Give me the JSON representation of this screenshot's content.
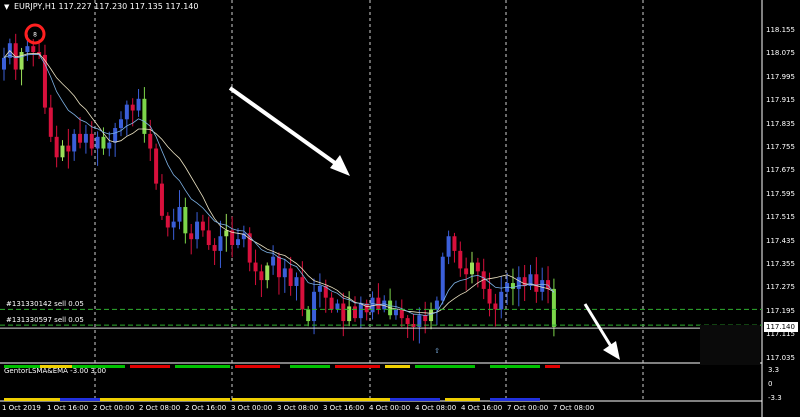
{
  "header": {
    "symbol": "EURJPY,H1",
    "ohlc": "117.227 117.230 117.135 117.140",
    "marker_digit": "8"
  },
  "orders": [
    {
      "label": "#131330142 sell 0.05",
      "price": 117.2
    },
    {
      "label": "#131330597 sell 0.05",
      "price": 117.146
    }
  ],
  "indicator": {
    "title": "GentorLSMA&EMA -3.00 3.00",
    "ticks": [
      "3.3",
      "0",
      "-3.3"
    ]
  },
  "price_axis": {
    "labels": [
      "118.155",
      "118.075",
      "117.995",
      "117.915",
      "117.835",
      "117.755",
      "117.675",
      "117.595",
      "117.515",
      "117.435",
      "117.355",
      "117.275",
      "117.195",
      "117.115",
      "117.035"
    ],
    "current_price": "117.140"
  },
  "time_axis": {
    "labels": [
      "1 Oct 2019",
      "1 Oct 16:00",
      "2 Oct 00:00",
      "2 Oct 08:00",
      "2 Oct 16:00",
      "3 Oct 00:00",
      "3 Oct 08:00",
      "3 Oct 16:00",
      "4 Oct 00:00",
      "4 Oct 08:00",
      "4 Oct 16:00",
      "7 Oct 00:00",
      "7 Oct 08:00"
    ]
  },
  "colors": {
    "bull": "#3b5fd9",
    "bear": "#d8103c",
    "bull_green": "#9be05a",
    "bear_green": "#7cd64a",
    "ma": "#ede4c4",
    "ema": "#7fb4e8",
    "order_line": "#2fae2f",
    "indicator_green": "#00c000",
    "indicator_red": "#e00000",
    "indicator_yellow": "#f0d000",
    "indicator_blue": "#2030e0"
  },
  "chart_data": {
    "type": "candlestick",
    "symbol": "EURJPY",
    "timeframe": "H1",
    "ylim": [
      117.02,
      118.21
    ],
    "closes": [
      118.06,
      118.11,
      118.02,
      118.08,
      118.1,
      118.08,
      118.07,
      117.89,
      117.79,
      117.72,
      117.76,
      117.74,
      117.8,
      117.77,
      117.8,
      117.75,
      117.79,
      117.75,
      117.77,
      117.82,
      117.85,
      117.9,
      117.88,
      117.92,
      117.8,
      117.75,
      117.63,
      117.52,
      117.48,
      117.5,
      117.55,
      117.46,
      117.44,
      117.5,
      117.47,
      117.42,
      117.4,
      117.45,
      117.47,
      117.42,
      117.44,
      117.46,
      117.36,
      117.33,
      117.3,
      117.35,
      117.38,
      117.31,
      117.34,
      117.28,
      117.31,
      117.2,
      117.16,
      117.26,
      117.28,
      117.24,
      117.2,
      117.22,
      117.16,
      117.21,
      117.17,
      117.22,
      117.19,
      117.24,
      117.2,
      117.23,
      117.18,
      117.2,
      117.17,
      117.15,
      117.14,
      117.18,
      117.16,
      117.2,
      117.23,
      117.38,
      117.45,
      117.4,
      117.34,
      117.32,
      117.36,
      117.33,
      117.27,
      117.22,
      117.2,
      117.26,
      117.29,
      117.27,
      117.31,
      117.28,
      117.32,
      117.26,
      117.3,
      117.27,
      117.14
    ]
  }
}
